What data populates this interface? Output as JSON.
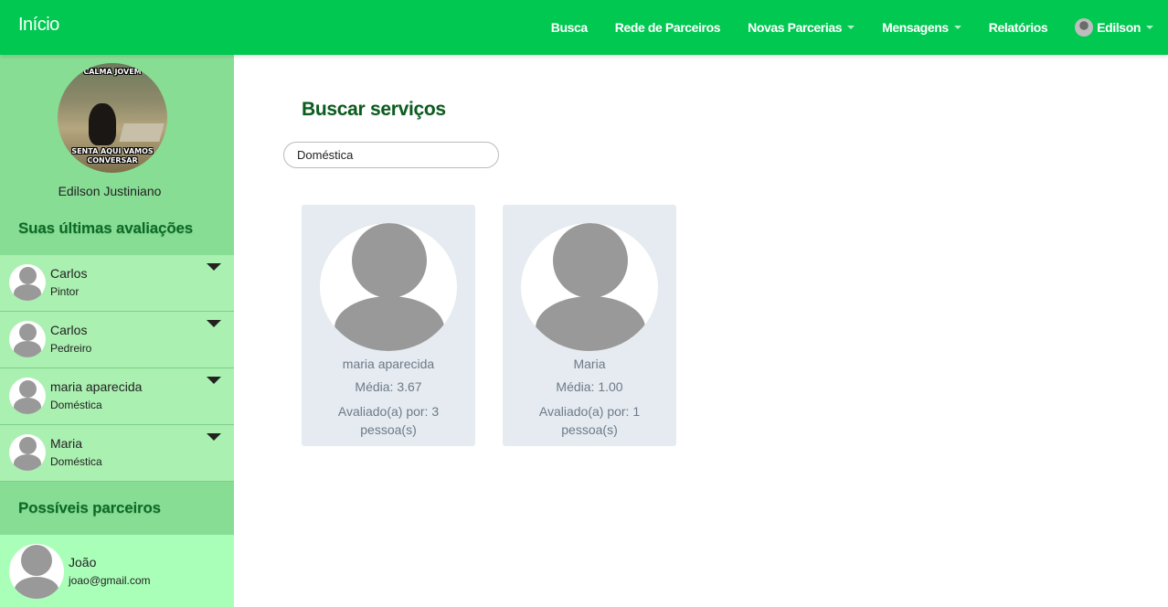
{
  "navbar": {
    "brand": "Início",
    "items": [
      {
        "label": "Busca",
        "dropdown": false
      },
      {
        "label": "Rede de Parceiros",
        "dropdown": false
      },
      {
        "label": "Novas Parcerias",
        "dropdown": true
      },
      {
        "label": "Mensagens",
        "dropdown": true
      },
      {
        "label": "Relatórios",
        "dropdown": false
      }
    ],
    "user_label": "Edilson",
    "colors": {
      "primary": "#00c851"
    }
  },
  "sidebar": {
    "profile_meme_top": "CALMA JOVEM",
    "profile_meme_bottom": "SENTA AQUI VAMOS CONVERSAR",
    "profile_name": "Edilson Justiniano",
    "evaluations_title": "Suas últimas avaliações",
    "evaluations": [
      {
        "name": "Carlos",
        "role": "Pintor"
      },
      {
        "name": "Carlos",
        "role": "Pedreiro"
      },
      {
        "name": "maria aparecida",
        "role": "Doméstica"
      },
      {
        "name": "Maria",
        "role": "Doméstica"
      }
    ],
    "partners_title": "Possíveis parceiros",
    "partners": [
      {
        "name": "João",
        "email": "joao@gmail.com"
      }
    ]
  },
  "main": {
    "title": "Buscar serviços",
    "search": {
      "value": "Doméstica"
    },
    "results": [
      {
        "name": "maria aparecida",
        "average": "Média: 3.67",
        "rated_by": "Avaliado(a) por: 3 pessoa(s)"
      },
      {
        "name": "Maria",
        "average": "Média: 1.00",
        "rated_by": "Avaliado(a) por: 1 pessoa(s)"
      }
    ]
  }
}
